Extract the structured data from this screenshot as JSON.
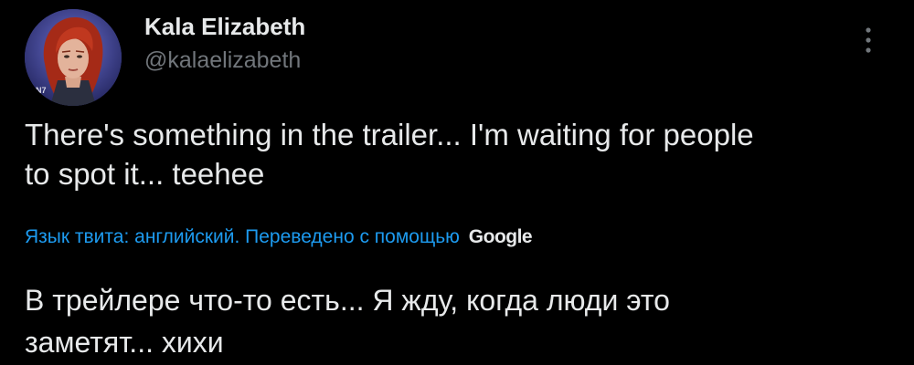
{
  "author": {
    "name": "Kala Elizabeth",
    "handle": "@kalaelizabeth"
  },
  "avatar": {
    "icon": "profile-avatar",
    "bg_color": "#3a3d8a",
    "hair_color": "#b8321c"
  },
  "tweet": {
    "text_lines": [
      "There's something in the trailer... I'm waiting for people",
      "to spot it... teehee"
    ]
  },
  "translation": {
    "label": "Язык твита: английский. Переведено с помощью",
    "provider": "Google",
    "label_color": "#1d9bf0",
    "text_lines": [
      "В трейлере что-то есть... Я жду, когда люди это",
      "заметят... хихи"
    ]
  },
  "menu": {
    "icon": "more-vertical-icon"
  },
  "colors": {
    "background": "#000000",
    "primary_text": "#e7e9ea",
    "secondary_text": "#71767b",
    "link": "#1d9bf0"
  }
}
